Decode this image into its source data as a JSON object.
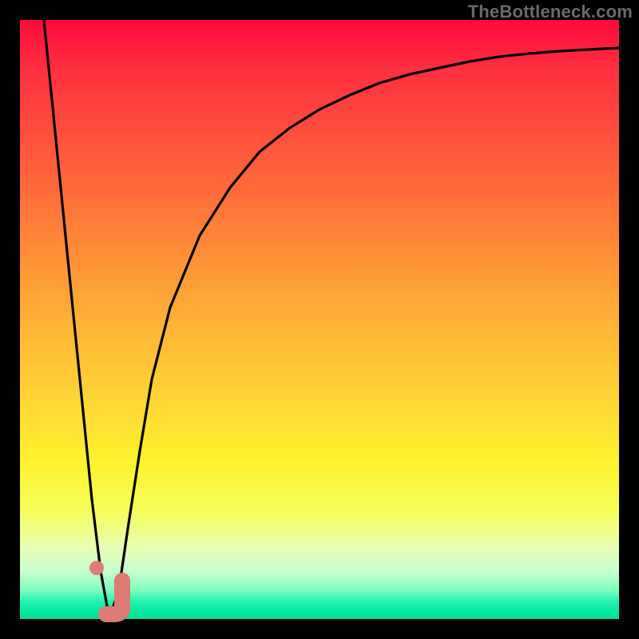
{
  "watermark": "TheBottleneck.com",
  "colors": {
    "frame": "#000000",
    "curve": "#000000",
    "marker": "#dd7c72",
    "gradient_top": "#ff0a3a",
    "gradient_bottom": "#00df98"
  },
  "chart_data": {
    "type": "line",
    "title": "",
    "xlabel": "",
    "ylabel": "",
    "xlim": [
      0,
      100
    ],
    "ylim": [
      0,
      100
    ],
    "grid": false,
    "legend": false,
    "gradient_meaning": "red = high bottleneck, green = low bottleneck (y-axis color, top-to-bottom)",
    "series": [
      {
        "name": "bottleneck-curve",
        "x": [
          4,
          6,
          8,
          10,
          12,
          13.5,
          15,
          16.5,
          18,
          20,
          22,
          25,
          30,
          35,
          40,
          45,
          50,
          55,
          60,
          65,
          70,
          75,
          80,
          85,
          90,
          95,
          100
        ],
        "y": [
          100,
          80,
          60,
          40,
          20,
          8,
          0,
          5,
          15,
          28,
          40,
          52,
          64,
          72,
          78,
          82,
          85,
          87.5,
          89.5,
          91,
          92,
          93,
          93.8,
          94.4,
          94.8,
          95.1,
          95.4
        ]
      }
    ],
    "markers": [
      {
        "name": "dot",
        "shape": "circle",
        "x": 12.8,
        "y": 8.5,
        "r": 1.2
      },
      {
        "name": "hook",
        "shape": "J",
        "x": 15.2,
        "y": 1.0,
        "stroke_w": 2.6
      }
    ]
  }
}
